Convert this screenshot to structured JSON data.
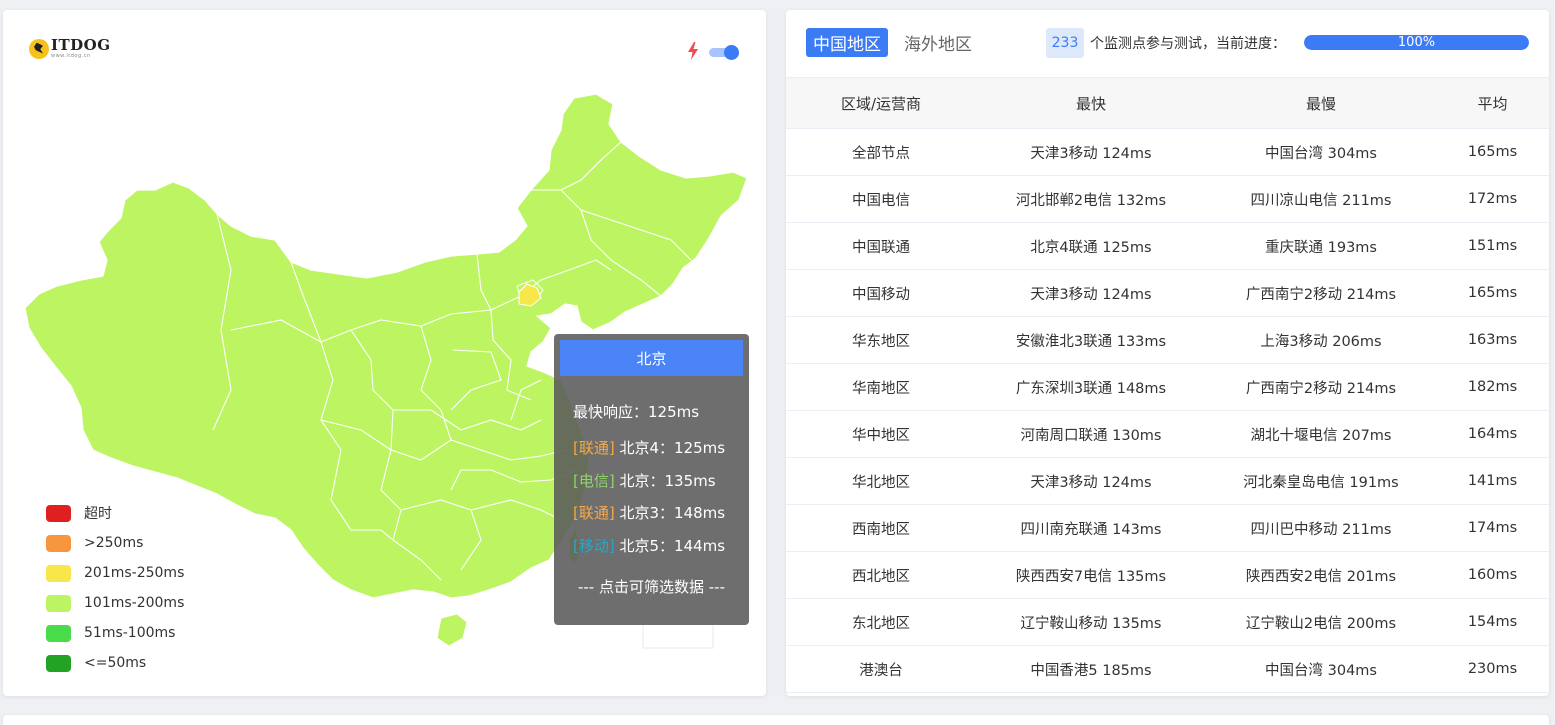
{
  "logo": {
    "title": "ITDOG",
    "subtitle": "www.itdog.cn"
  },
  "map_toggle": {
    "on": true
  },
  "legend": [
    {
      "label": "超时",
      "color": "#e02020"
    },
    {
      "label": ">250ms",
      "color": "#f7963c"
    },
    {
      "label": "201ms-250ms",
      "color": "#f8e74a"
    },
    {
      "label": "101ms-200ms",
      "color": "#bdf562"
    },
    {
      "label": "51ms-100ms",
      "color": "#48dc4a"
    },
    {
      "label": "<=50ms",
      "color": "#23a324"
    }
  ],
  "map_colors": {
    "provinces": "#bdf562",
    "highlight": "#f8e74a",
    "border": "#ffffff"
  },
  "tooltip": {
    "title": "北京",
    "fastest": "最快响应：125ms",
    "rows": [
      {
        "isp": "[联通]",
        "isp_color": "#f4a94a",
        "text": "北京4：125ms"
      },
      {
        "isp": "[电信]",
        "isp_color": "#8fd46c",
        "text": "北京：135ms"
      },
      {
        "isp": "[联通]",
        "isp_color": "#f4a94a",
        "text": "北京3：148ms"
      },
      {
        "isp": "[移动]",
        "isp_color": "#2aa6c8",
        "text": "北京5：144ms"
      }
    ],
    "hint": "--- 点击可筛选数据 ---"
  },
  "tabs": {
    "active": "中国地区",
    "inactive": "海外地区"
  },
  "monitor": {
    "count": "233",
    "text": "个监测点参与测试，当前进度：",
    "progress_label": "100%",
    "progress_value": 1.0
  },
  "table": {
    "headers": [
      "区域/运营商",
      "最快",
      "最慢",
      "平均"
    ],
    "rows": [
      [
        "全部节点",
        "天津3移动 124ms",
        "中国台湾 304ms",
        "165ms"
      ],
      [
        "中国电信",
        "河北邯郸2电信 132ms",
        "四川凉山电信 211ms",
        "172ms"
      ],
      [
        "中国联通",
        "北京4联通 125ms",
        "重庆联通 193ms",
        "151ms"
      ],
      [
        "中国移动",
        "天津3移动 124ms",
        "广西南宁2移动 214ms",
        "165ms"
      ],
      [
        "华东地区",
        "安徽淮北3联通 133ms",
        "上海3移动 206ms",
        "163ms"
      ],
      [
        "华南地区",
        "广东深圳3联通 148ms",
        "广西南宁2移动 214ms",
        "182ms"
      ],
      [
        "华中地区",
        "河南周口联通 130ms",
        "湖北十堰电信 207ms",
        "164ms"
      ],
      [
        "华北地区",
        "天津3移动 124ms",
        "河北秦皇岛电信 191ms",
        "141ms"
      ],
      [
        "西南地区",
        "四川南充联通 143ms",
        "四川巴中移动 211ms",
        "174ms"
      ],
      [
        "西北地区",
        "陕西西安7电信 135ms",
        "陕西西安2电信 201ms",
        "160ms"
      ],
      [
        "东北地区",
        "辽宁鞍山移动 135ms",
        "辽宁鞍山2电信 200ms",
        "154ms"
      ],
      [
        "港澳台",
        "中国香港5 185ms",
        "中国台湾 304ms",
        "230ms"
      ]
    ]
  }
}
